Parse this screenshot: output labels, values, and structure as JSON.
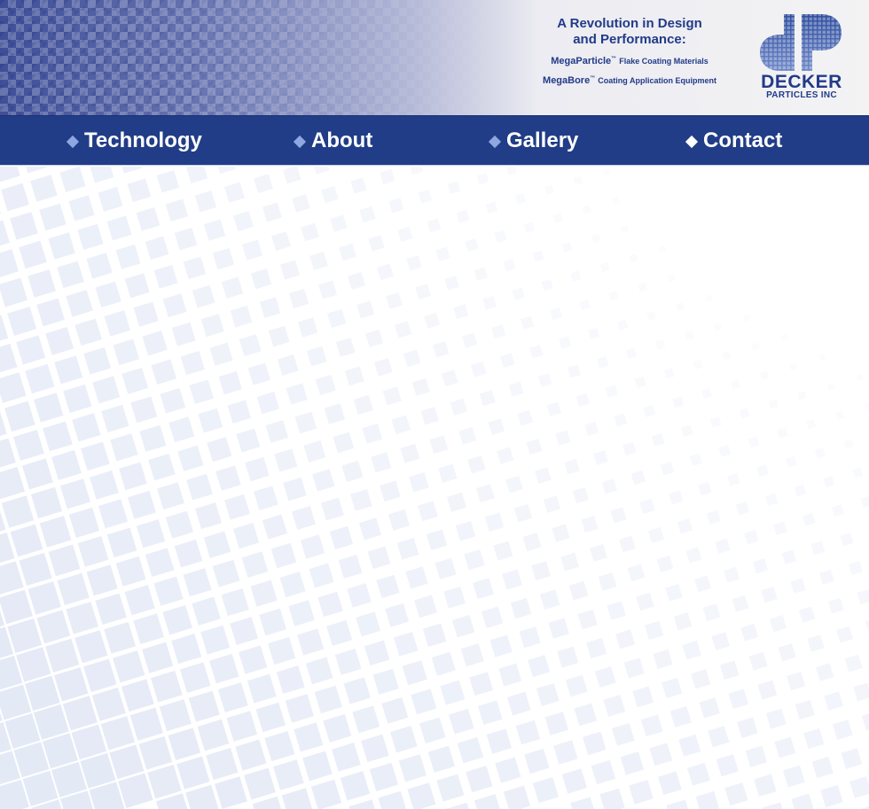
{
  "header": {
    "tagline_line1": "A Revolution in Design",
    "tagline_line2": "and Performance:",
    "products": [
      {
        "name": "MegaParticle",
        "tm": "™",
        "desc": "Flake Coating Materials"
      },
      {
        "name": "MegaBore",
        "tm": "™",
        "desc": "Coating Application Equipment"
      }
    ],
    "logo": {
      "word": "DECKER",
      "sub": "PARTICLES INC",
      "icon": "dp-monogram-icon"
    }
  },
  "nav": {
    "items": [
      {
        "label": "Technology",
        "icon": "diamond-bullet-icon"
      },
      {
        "label": "About",
        "icon": "diamond-bullet-icon"
      },
      {
        "label": "Gallery",
        "icon": "diamond-bullet-icon"
      },
      {
        "label": "Contact",
        "icon": "diamond-bullet-icon"
      }
    ]
  },
  "colors": {
    "brand_blue": "#213d87",
    "logo_blue": "#223a88",
    "bullet_light": "#8fa7e0",
    "pattern_tile": "#dfe5f4"
  }
}
